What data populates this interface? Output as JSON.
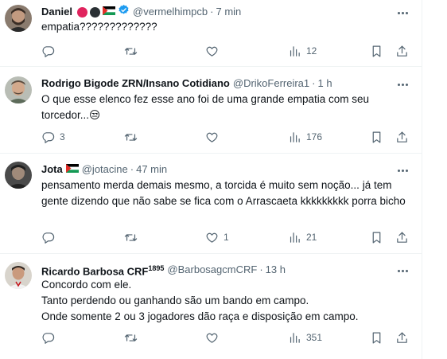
{
  "tweets": [
    {
      "name": "Daniel",
      "handle": "@vermelhimpcb",
      "time": "7 min",
      "text": "empatia?????????????",
      "replies": "",
      "retweets": "",
      "likes": "",
      "views": "12"
    },
    {
      "name": "Rodrigo Bigode ZRN/Insano Cotidiano",
      "handle": "@DrikoFerreira1",
      "time": "1 h",
      "text": "O que esse elenco fez esse ano foi de uma grande empatia com seu torcedor...😒",
      "replies": "3",
      "retweets": "",
      "likes": "",
      "views": "176"
    },
    {
      "name": "Jota",
      "handle": "@jotacine",
      "time": "47 min",
      "text": "pensamento merda demais mesmo, a torcida é muito sem noção... já tem gente dizendo que não sabe se fica com o Arrascaeta kkkkkkkkk porra bicho",
      "replies": "",
      "retweets": "",
      "likes": "1",
      "views": "21"
    },
    {
      "name": "Ricardo Barbosa CRF",
      "name_sup": "1895",
      "handle": "@BarbosagcmCRF",
      "time": "13 h",
      "text_lines": [
        "Concordo com ele.",
        "Tanto perdendo ou ganhando são um bando em campo.",
        "Onde somente 2 ou 3 jogadores dão raça e disposição em campo."
      ],
      "replies": "",
      "retweets": "",
      "likes": "",
      "views": "351"
    }
  ],
  "separator": "·",
  "colors": {
    "text": "#0f1419",
    "muted": "#536471",
    "verified": "#1d9bf0",
    "border": "#eff3f4"
  },
  "icons": [
    "reply-icon",
    "retweet-icon",
    "like-icon",
    "views-icon",
    "bookmark-icon",
    "share-icon",
    "more-icon",
    "verified-icon",
    "palestine-flag-icon"
  ]
}
